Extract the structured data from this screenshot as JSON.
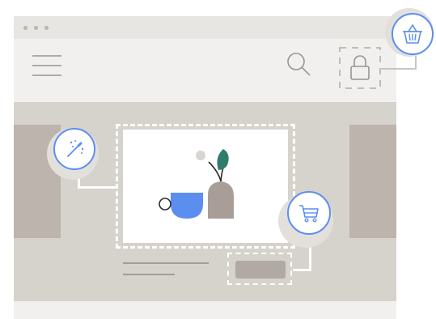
{
  "window": {
    "controls": [
      "close",
      "minimize",
      "maximize"
    ]
  },
  "toolbar": {
    "menu_icon": "hamburger-menu-icon",
    "search_icon": "search-icon",
    "lock_icon": "padlock-icon"
  },
  "badges": {
    "top_right": "shopping-basket-icon",
    "left": "magic-wand-icon",
    "right": "shopping-cart-icon"
  },
  "colors": {
    "accent_blue": "#5c8ef0",
    "leaf_green": "#2e7d6b",
    "vase_taupe": "#a89e97",
    "panel_gray": "#d6d2cc",
    "window_bg": "#f1f0ee",
    "icon_gray": "#8a8580"
  }
}
